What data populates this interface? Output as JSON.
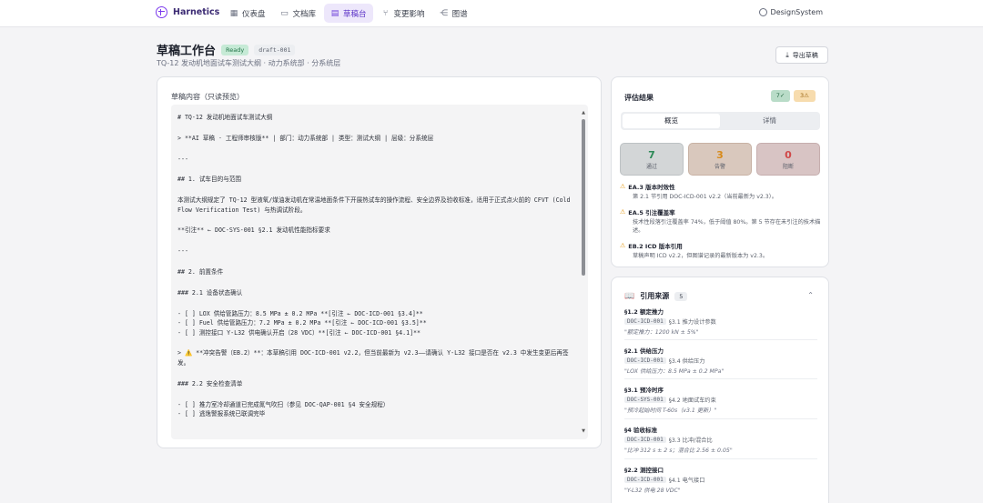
{
  "nav": {
    "brand": "Harnetics",
    "items": [
      {
        "label": "仪表盘",
        "icon": "grid-icon",
        "active": false
      },
      {
        "label": "文档库",
        "icon": "book-icon",
        "active": false
      },
      {
        "label": "草稿台",
        "icon": "file-icon",
        "active": true
      },
      {
        "label": "变更影响",
        "icon": "branch-icon",
        "active": false
      },
      {
        "label": "图谱",
        "icon": "share-icon",
        "active": false
      }
    ],
    "workspace": "DesignSystem"
  },
  "header": {
    "title": "草稿工作台",
    "status_badge": "Ready",
    "draft_id": "draft-001",
    "subtitle": "TQ-12 发动机地面试车测试大纲 · 动力系统部 · 分系统层",
    "export_label": "导出草稿"
  },
  "draft": {
    "title": "草稿内容（只读预览）",
    "lines": [
      "# TQ-12 发动机地面试车测试大纲",
      "",
      "> **AI 草稿 · 工程师审核版** | 部门：动力系统部 | 类型：测试大纲 | 层级：分系统层",
      "",
      "---",
      "",
      "## 1. 试车目的与范围",
      "",
      "本测试大纲规定了 TQ-12 型液氧/煤油发动机在常温地面条件下开展热试车的操作流程、安全边界及验收标准，适用于正式点火前的 CFVT (Cold Flow Verification Test) 与热调试阶段。",
      "",
      "**引注** ← DOC-SYS-001 §2.1 发动机性能指标要求",
      "",
      "---",
      "",
      "## 2. 前置条件",
      "",
      "### 2.1 设备状态确认",
      "",
      "- [ ] LOX 供给管路压力：8.5 MPa ± 0.2 MPa **[引注 ← DOC-ICD-001 §3.4]**",
      "- [ ] Fuel 供给管路压力：7.2 MPa ± 0.2 MPa **[引注 ← DOC-ICD-001 §3.5]**",
      "- [ ] 测控接口 Y-L32 供电确认开启（28 VDC）**[引注 ← DOC-ICD-001 §4.1]**",
      "",
      "> ⚠️ **冲突告警（EB.2）**：本草稿引用 DOC-ICD-001 v2.2，但当前最新为 v2.3——请确认 Y-L32 接口是否在 v2.3 中发生变更后再签发。",
      "",
      "### 2.2 安全检查清单",
      "",
      "- [ ] 推力室冷却通道已完成氮气吹扫（参见 DOC-QAP-001 §4 安全规程）",
      "- [ ] 逃逸警报系统已联调完毕"
    ]
  },
  "evaluation": {
    "title": "评估结果",
    "pass_chip": "7✓",
    "warn_chip": "3⚠",
    "tabs": [
      "概览",
      "详情"
    ],
    "stats": [
      {
        "value": "7",
        "label": "通过"
      },
      {
        "value": "3",
        "label": "告警"
      },
      {
        "value": "0",
        "label": "阻断"
      }
    ],
    "issues": [
      {
        "code": "EA.3 版本时效性",
        "detail": "第 2.1 节引用 DOC-ICD-001 v2.2（当前最新为 v2.3）。"
      },
      {
        "code": "EA.5 引注覆盖率",
        "detail": "技术性段落引注覆盖率 74%，低于阈值 80%。第 5 节存在未引注的技术描述。"
      },
      {
        "code": "EB.2 ICD 版本引用",
        "detail": "草稿声明 ICD v2.2，但图谱记录的最新版本为 v2.3。"
      }
    ]
  },
  "references": {
    "title": "引用来源",
    "count": "5",
    "items": [
      {
        "section": "§1.2 额定推力",
        "doc": "DOC-ICD-001",
        "loc": "§3.1 推力设计参数",
        "quote": "\"额定推力：1200 kN ± 5%\""
      },
      {
        "section": "§2.1 供给压力",
        "doc": "DOC-ICD-001",
        "loc": "§3.4 供给压力",
        "quote": "\"LOX 供给压力：8.5 MPa ± 0.2 MPa\""
      },
      {
        "section": "§3.1 预冷时序",
        "doc": "DOC-SYS-001",
        "loc": "§4.2 地面试车约束",
        "quote": "\"预冷起始时间 T-60s（v3.1 更新）\""
      },
      {
        "section": "§4 验收标准",
        "doc": "DOC-ICD-001",
        "loc": "§3.3 比冲/混合比",
        "quote": "\"比冲 312 s ± 2 s；混合比 2.56 ± 0.05\""
      },
      {
        "section": "§2.2 测控接口",
        "doc": "DOC-ICD-001",
        "loc": "§4.1 电气接口",
        "quote": "\"Y-L32 供电 28 VDC\""
      }
    ]
  }
}
